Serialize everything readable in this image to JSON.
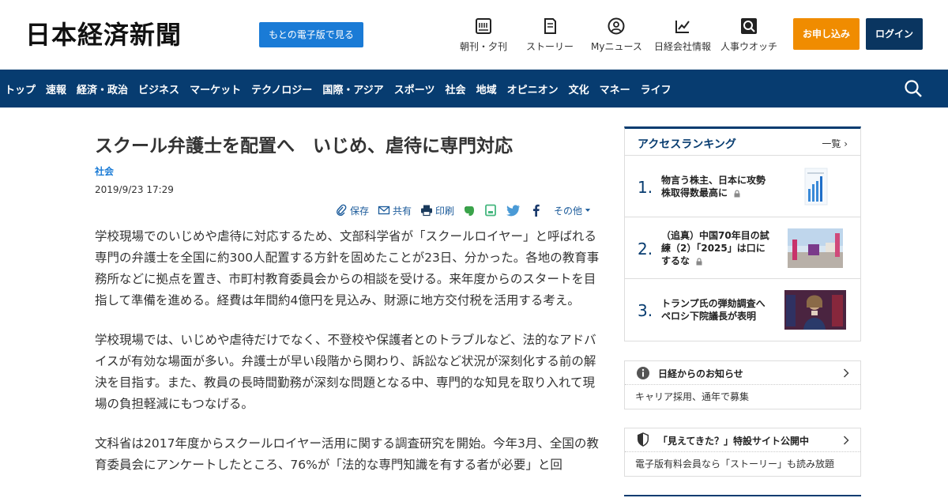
{
  "header": {
    "logo": "日本経済新聞",
    "paper_button": "もとの電子版で見る",
    "nav": [
      {
        "label": "朝刊・夕刊",
        "icon": "newspaper-icon"
      },
      {
        "label": "ストーリー",
        "icon": "story-icon"
      },
      {
        "label": "Myニュース",
        "icon": "user-icon"
      },
      {
        "label": "日経会社情報",
        "icon": "chart-icon"
      },
      {
        "label": "人事ウオッチ",
        "icon": "search-person-icon"
      }
    ],
    "apply_button": "お申し込み",
    "login_button": "ログイン"
  },
  "navbar": {
    "items": [
      "トップ",
      "速報",
      "経済・政治",
      "ビジネス",
      "マーケット",
      "テクノロジー",
      "国際・アジア",
      "スポーツ",
      "社会",
      "地域",
      "オピニオン",
      "文化",
      "マネー",
      "ライフ"
    ],
    "search_icon": "search-icon"
  },
  "article": {
    "title": "スクール弁護士を配置へ　いじめ、虐待に専門対応",
    "category": "社会",
    "date": "2019/9/23 17:29",
    "share": {
      "save": "保存",
      "share": "共有",
      "print": "印刷",
      "more": "その他"
    },
    "paragraphs": [
      "学校現場でのいじめや虐待に対応するため、文部科学省が「スクールロイヤー」と呼ばれる専門の弁護士を全国に約300人配置する方針を固めたことが23日、分かった。各地の教育事務所などに拠点を置き、市町村教育委員会からの相談を受ける。来年度からのスタートを目指して準備を進める。経費は年間約4億円を見込み、財源に地方交付税を活用する考え。",
      "学校現場では、いじめや虐待だけでなく、不登校や保護者とのトラブルなど、法的なアドバイスが有効な場面が多い。弁護士が早い段階から関わり、訴訟など状況が深刻化する前の解決を目指す。また、教員の長時間勤務が深刻な問題となる中、専門的な知見を取り入れて現場の負担軽減にもつなげる。",
      "文科省は2017年度からスクールロイヤー活用に関する調査研究を開始。今年3月、全国の教育委員会にアンケートしたところ、76%が「法的な専門知識を有する者が必要」と回"
    ]
  },
  "sidebar": {
    "ranking": {
      "title": "アクセスランキング",
      "more": "一覧",
      "items": [
        {
          "rank": "1.",
          "text": "物言う株主、日本に攻勢　株取得数最高に",
          "locked": true
        },
        {
          "rank": "2.",
          "text": "（追真）中国70年目の試練（2）「2025」は口にするな",
          "locked": true
        },
        {
          "rank": "3.",
          "text": "トランプ氏の弾劾調査へ　ペロシ下院議長が表明",
          "locked": false
        }
      ]
    },
    "notice": {
      "title": "日経からのお知らせ",
      "body": "キャリア採用、通年で募集"
    },
    "promo": {
      "title": "「見えてきた？」特設サイト公開中",
      "body": "電子版有料会員なら「ストーリー」も読み放題"
    }
  }
}
